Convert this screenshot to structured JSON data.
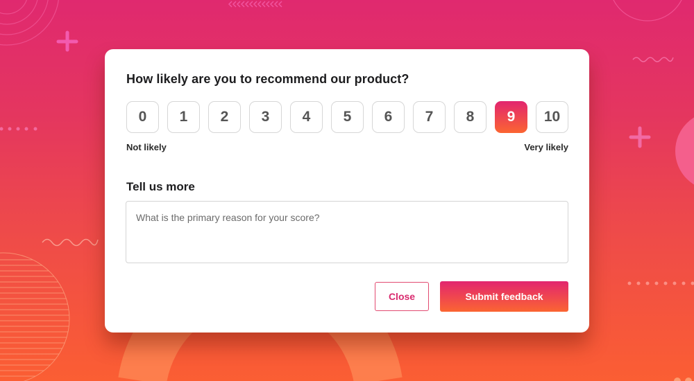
{
  "survey": {
    "question": "How likely are you to recommend our product?",
    "scale": {
      "options": [
        "0",
        "1",
        "2",
        "3",
        "4",
        "5",
        "6",
        "7",
        "8",
        "9",
        "10"
      ],
      "selected": "9",
      "low_label": "Not likely",
      "high_label": "Very likely"
    },
    "comment": {
      "heading": "Tell us more",
      "placeholder": "What is the primary reason for your score?",
      "value": ""
    },
    "actions": {
      "close_label": "Close",
      "submit_label": "Submit feedback"
    }
  },
  "theme": {
    "gradient_top": "#e2256f",
    "gradient_bottom": "#fb6532",
    "accent_text": "#d92a6e"
  }
}
